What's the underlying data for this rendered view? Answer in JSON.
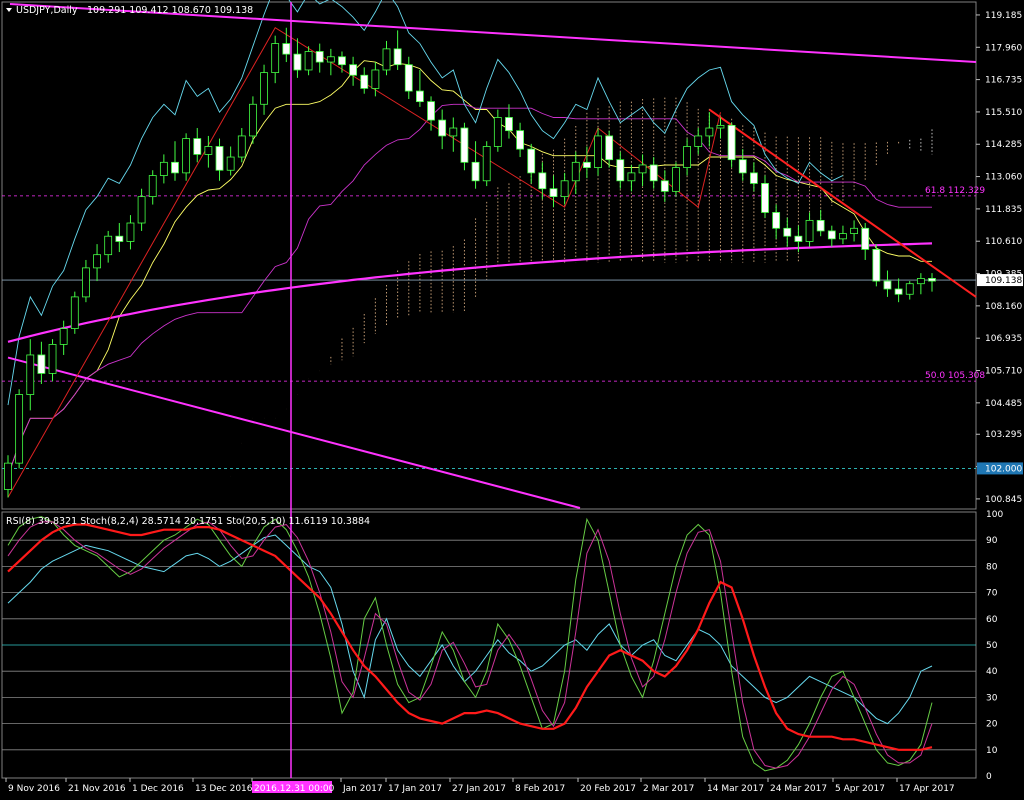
{
  "chart_data": {
    "type": "candlestick",
    "symbol_label": "USDJPY,Daily",
    "ohlc_label": "109.291 109.412 108.670 109.138",
    "price_axis": {
      "ylim": [
        100.5,
        119.6
      ],
      "ticks": [
        "119.185",
        "117.960",
        "116.735",
        "115.510",
        "114.285",
        "113.060",
        "111.835",
        "110.610",
        "109.385",
        "108.160",
        "106.935",
        "105.710",
        "104.485",
        "103.295",
        "102.070",
        "100.845"
      ],
      "current_price": "109.138",
      "marked_level": "102.000"
    },
    "fib_levels": [
      {
        "label": "61.8 112.329",
        "value": 112.329
      },
      {
        "label": "50.0 105.308",
        "value": 105.308
      }
    ],
    "date_axis": {
      "labels": [
        "9 Nov 2016",
        "21 Nov 2016",
        "1 Dec 2016",
        "13 Dec 2016",
        "2016.12.31 00:00",
        "Jan 2017",
        "17 Jan 2017",
        "27 Jan 2017",
        "8 Feb 2017",
        "20 Feb 2017",
        "2 Mar 2017",
        "14 Mar 2017",
        "24 Mar 2017",
        "5 Apr 2017",
        "17 Apr 2017"
      ]
    },
    "candles": [
      [
        101.2,
        102.5,
        100.9,
        102.2
      ],
      [
        102.2,
        105.0,
        102.0,
        104.8
      ],
      [
        104.8,
        106.9,
        104.2,
        106.3
      ],
      [
        106.3,
        106.8,
        105.2,
        105.6
      ],
      [
        105.6,
        106.9,
        105.3,
        106.7
      ],
      [
        106.7,
        107.6,
        106.3,
        107.3
      ],
      [
        107.3,
        108.7,
        107.1,
        108.5
      ],
      [
        108.5,
        109.9,
        108.3,
        109.6
      ],
      [
        109.6,
        110.5,
        109.1,
        110.1
      ],
      [
        110.1,
        111.0,
        109.8,
        110.8
      ],
      [
        110.8,
        111.3,
        110.2,
        110.6
      ],
      [
        110.6,
        111.6,
        110.3,
        111.3
      ],
      [
        111.3,
        112.6,
        111.0,
        112.3
      ],
      [
        112.3,
        113.3,
        112.0,
        113.1
      ],
      [
        113.1,
        113.9,
        112.8,
        113.6
      ],
      [
        113.6,
        114.4,
        112.9,
        113.2
      ],
      [
        113.2,
        114.7,
        112.9,
        114.5
      ],
      [
        114.5,
        114.9,
        113.6,
        113.9
      ],
      [
        113.9,
        114.6,
        113.4,
        114.2
      ],
      [
        114.2,
        114.5,
        112.9,
        113.3
      ],
      [
        113.3,
        114.2,
        113.1,
        113.8
      ],
      [
        113.8,
        114.9,
        113.6,
        114.6
      ],
      [
        114.6,
        116.1,
        114.3,
        115.8
      ],
      [
        115.8,
        117.3,
        115.4,
        117.0
      ],
      [
        117.0,
        118.4,
        116.6,
        118.1
      ],
      [
        118.1,
        118.7,
        117.4,
        117.7
      ],
      [
        117.7,
        118.3,
        116.8,
        117.1
      ],
      [
        117.1,
        118.0,
        116.9,
        117.8
      ],
      [
        117.8,
        118.1,
        117.0,
        117.4
      ],
      [
        117.4,
        117.9,
        116.9,
        117.6
      ],
      [
        117.6,
        117.8,
        117.0,
        117.3
      ],
      [
        117.3,
        117.6,
        116.5,
        116.9
      ],
      [
        116.9,
        117.2,
        116.2,
        116.4
      ],
      [
        116.4,
        117.4,
        116.1,
        117.1
      ],
      [
        117.1,
        118.2,
        116.9,
        117.9
      ],
      [
        117.9,
        118.6,
        117.1,
        117.3
      ],
      [
        117.3,
        117.6,
        116.0,
        116.3
      ],
      [
        116.3,
        117.1,
        115.7,
        115.9
      ],
      [
        115.9,
        116.1,
        114.8,
        115.2
      ],
      [
        115.2,
        115.6,
        114.1,
        114.6
      ],
      [
        114.6,
        115.3,
        114.0,
        114.9
      ],
      [
        114.9,
        115.1,
        113.3,
        113.6
      ],
      [
        113.6,
        114.4,
        112.6,
        112.9
      ],
      [
        112.9,
        114.4,
        112.7,
        114.2
      ],
      [
        114.2,
        115.6,
        114.0,
        115.3
      ],
      [
        115.3,
        115.8,
        114.5,
        114.8
      ],
      [
        114.8,
        115.1,
        113.8,
        114.1
      ],
      [
        114.1,
        114.3,
        112.8,
        113.2
      ],
      [
        113.2,
        113.6,
        112.2,
        112.6
      ],
      [
        112.6,
        113.1,
        111.9,
        112.3
      ],
      [
        112.3,
        113.2,
        112.0,
        112.9
      ],
      [
        112.9,
        114.0,
        112.4,
        113.6
      ],
      [
        113.6,
        114.2,
        113.0,
        113.4
      ],
      [
        113.4,
        114.9,
        113.1,
        114.6
      ],
      [
        114.6,
        114.8,
        113.4,
        113.7
      ],
      [
        113.7,
        114.0,
        112.6,
        112.9
      ],
      [
        112.9,
        113.5,
        112.5,
        113.2
      ],
      [
        113.2,
        113.9,
        112.7,
        113.5
      ],
      [
        113.5,
        113.8,
        112.6,
        112.9
      ],
      [
        112.9,
        113.3,
        112.1,
        112.5
      ],
      [
        112.5,
        113.6,
        112.3,
        113.4
      ],
      [
        113.4,
        114.5,
        113.1,
        114.2
      ],
      [
        114.2,
        114.9,
        113.9,
        114.6
      ],
      [
        114.6,
        115.5,
        114.2,
        114.9
      ],
      [
        114.9,
        115.3,
        114.5,
        115.0
      ],
      [
        115.0,
        115.1,
        113.4,
        113.7
      ],
      [
        113.7,
        114.1,
        112.9,
        113.2
      ],
      [
        113.2,
        113.6,
        112.5,
        112.8
      ],
      [
        112.8,
        113.1,
        111.5,
        111.7
      ],
      [
        111.7,
        112.0,
        110.7,
        111.1
      ],
      [
        111.1,
        111.5,
        110.4,
        110.8
      ],
      [
        110.8,
        111.2,
        110.2,
        110.6
      ],
      [
        110.6,
        111.7,
        110.4,
        111.4
      ],
      [
        111.4,
        111.8,
        110.8,
        111.0
      ],
      [
        111.0,
        111.2,
        110.4,
        110.7
      ],
      [
        110.7,
        111.2,
        110.5,
        110.9
      ],
      [
        110.9,
        111.4,
        110.6,
        111.1
      ],
      [
        111.1,
        111.3,
        109.9,
        110.3
      ],
      [
        110.3,
        110.5,
        108.9,
        109.1
      ],
      [
        109.1,
        109.5,
        108.5,
        108.8
      ],
      [
        108.8,
        109.2,
        108.3,
        108.6
      ],
      [
        108.6,
        109.1,
        108.4,
        109.0
      ],
      [
        109.0,
        109.4,
        108.6,
        109.2
      ],
      [
        109.2,
        109.4,
        108.7,
        109.1
      ]
    ],
    "ma_200": {
      "color": "#ff33ff"
    },
    "oscillators": {
      "header_label": "RSI(8) 39.8321  Stoch(8,2,4) 28.5714 20.1751  Sto(20,5,10) 11.6119 10.3884",
      "ylim": [
        0,
        100
      ],
      "ticks": [
        "100",
        "90",
        "80",
        "70",
        "60",
        "50",
        "40",
        "30",
        "20",
        "10",
        "0"
      ],
      "rsi": [
        66,
        70,
        74,
        79,
        82,
        84,
        86,
        88,
        87,
        86,
        84,
        82,
        80,
        79,
        78,
        81,
        84,
        85,
        83,
        80,
        82,
        85,
        88,
        91,
        92,
        88,
        84,
        80,
        78,
        72,
        58,
        40,
        30,
        52,
        60,
        48,
        42,
        38,
        44,
        50,
        42,
        36,
        40,
        46,
        52,
        47,
        44,
        40,
        42,
        46,
        50,
        52,
        48,
        54,
        58,
        50,
        46,
        50,
        52,
        46,
        44,
        50,
        56,
        54,
        50,
        42,
        38,
        34,
        30,
        28,
        30,
        34,
        38,
        36,
        34,
        32,
        30,
        26,
        22,
        20,
        24,
        30,
        40,
        42
      ],
      "stoch_k": [
        88,
        95,
        98,
        99,
        97,
        92,
        88,
        86,
        84,
        80,
        76,
        78,
        82,
        86,
        90,
        92,
        95,
        98,
        96,
        90,
        84,
        80,
        88,
        95,
        98,
        94,
        86,
        76,
        62,
        45,
        24,
        32,
        60,
        68,
        50,
        35,
        28,
        30,
        42,
        55,
        48,
        36,
        30,
        40,
        58,
        52,
        42,
        30,
        18,
        20,
        40,
        75,
        98,
        90,
        70,
        50,
        38,
        30,
        44,
        62,
        80,
        92,
        96,
        92,
        70,
        40,
        15,
        5,
        2,
        3,
        6,
        12,
        20,
        30,
        38,
        40,
        30,
        20,
        10,
        5,
        4,
        6,
        12,
        28
      ],
      "stoch_d": [
        84,
        90,
        95,
        97,
        97,
        94,
        90,
        87,
        85,
        82,
        79,
        77,
        79,
        83,
        87,
        90,
        93,
        96,
        97,
        94,
        88,
        83,
        84,
        90,
        95,
        96,
        91,
        82,
        70,
        55,
        36,
        30,
        45,
        62,
        58,
        44,
        32,
        29,
        35,
        48,
        51,
        43,
        34,
        35,
        48,
        54,
        48,
        37,
        25,
        19,
        28,
        55,
        85,
        94,
        82,
        62,
        45,
        34,
        38,
        52,
        70,
        85,
        93,
        94,
        82,
        55,
        28,
        10,
        4,
        3,
        4,
        8,
        15,
        24,
        33,
        38,
        35,
        26,
        16,
        8,
        5,
        5,
        8,
        20
      ],
      "sto_slow": [
        78,
        82,
        86,
        90,
        93,
        95,
        96,
        96,
        95,
        94,
        93,
        92,
        92,
        93,
        94,
        94,
        94,
        95,
        95,
        94,
        92,
        90,
        88,
        86,
        84,
        80,
        76,
        72,
        68,
        62,
        55,
        48,
        42,
        38,
        33,
        28,
        24,
        22,
        21,
        20,
        22,
        24,
        24,
        25,
        24,
        22,
        20,
        19,
        18,
        18,
        20,
        26,
        34,
        40,
        46,
        48,
        46,
        44,
        40,
        38,
        42,
        48,
        56,
        66,
        74,
        72,
        60,
        46,
        34,
        24,
        18,
        16,
        15,
        15,
        15,
        14,
        14,
        13,
        12,
        11,
        10,
        10,
        10,
        11
      ],
      "levels_cyan": 50
    }
  }
}
